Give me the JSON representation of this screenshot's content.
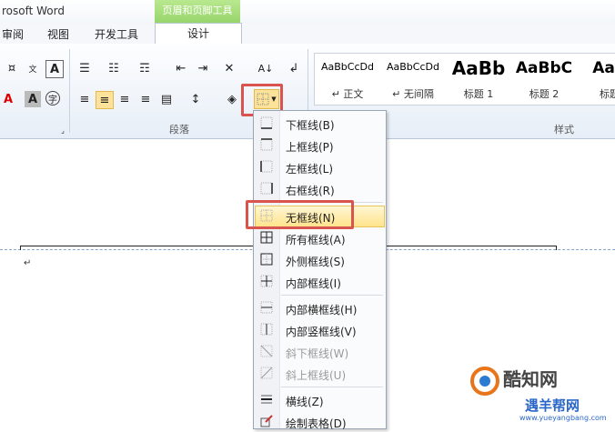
{
  "window": {
    "title": "rosoft Word",
    "context_tab_group": "页眉和页脚工具"
  },
  "tabs": [
    "审阅",
    "视图",
    "开发工具",
    "设计"
  ],
  "ribbon": {
    "group_paragraph": "段落",
    "group_styles": "样式",
    "styles": [
      {
        "preview": "AaBbCcDd",
        "name": "↵ 正文"
      },
      {
        "preview": "AaBbCcDd",
        "name": "↵ 无间隔"
      },
      {
        "preview": "AaBb",
        "name": "标题 1"
      },
      {
        "preview": "AaBbC",
        "name": "标题 2"
      },
      {
        "preview": "AaB",
        "name": "标题"
      }
    ]
  },
  "border_menu": {
    "items": [
      {
        "label": "下框线(B)",
        "enabled": true
      },
      {
        "label": "上框线(P)",
        "enabled": true
      },
      {
        "label": "左框线(L)",
        "enabled": true
      },
      {
        "label": "右框线(R)",
        "enabled": true
      },
      {
        "label": "无框线(N)",
        "enabled": true,
        "highlighted": true
      },
      {
        "label": "所有框线(A)",
        "enabled": true
      },
      {
        "label": "外侧框线(S)",
        "enabled": true
      },
      {
        "label": "内部框线(I)",
        "enabled": true
      },
      {
        "label": "内部横框线(H)",
        "enabled": true
      },
      {
        "label": "内部竖框线(V)",
        "enabled": true
      },
      {
        "label": "斜下框线(W)",
        "enabled": false
      },
      {
        "label": "斜上框线(U)",
        "enabled": false
      },
      {
        "label": "横线(Z)",
        "enabled": true
      },
      {
        "label": "绘制表格(D)",
        "enabled": true
      }
    ]
  },
  "document": {
    "paragraph_mark": "↵"
  },
  "watermark": {
    "brand": "酷知网",
    "slogan": "遇羊帮网",
    "url": "www.yueyangbang.com"
  },
  "colors": {
    "highlight_red": "#d9534f",
    "context_green": "#96d46a",
    "menu_hover": "#ffe48c"
  }
}
